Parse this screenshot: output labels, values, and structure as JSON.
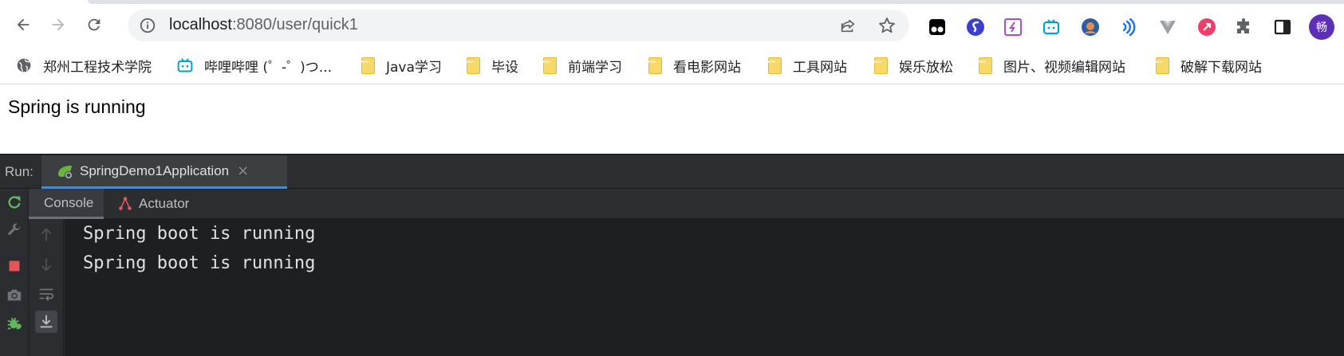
{
  "browser": {
    "url_host": "localhost",
    "url_rest": ":8080/user/quick1",
    "avatar_letter": "畅",
    "extensions": [
      "tampermonkey-icon",
      "s-icon",
      "feather-icon",
      "bilibili-ext-icon",
      "avatar-ext-icon",
      "wifi-ext-icon",
      "vue-icon",
      "ping-icon",
      "puzzle-icon",
      "sidepanel-icon"
    ]
  },
  "bookmarks": [
    {
      "label": "郑州工程技术学院",
      "icon": "globe-icon"
    },
    {
      "label": "哔哩哔哩 (゜-゜)つ...",
      "icon": "bilibili-icon"
    },
    {
      "label": "Java学习",
      "icon": "folder-icon"
    },
    {
      "label": "毕设",
      "icon": "folder-icon"
    },
    {
      "label": "前端学习",
      "icon": "folder-icon"
    },
    {
      "label": "看电影网站",
      "icon": "folder-icon"
    },
    {
      "label": "工具网站",
      "icon": "folder-icon"
    },
    {
      "label": "娱乐放松",
      "icon": "folder-icon"
    },
    {
      "label": "图片、视频编辑网站",
      "icon": "folder-icon"
    },
    {
      "label": "破解下载网站",
      "icon": "folder-icon"
    }
  ],
  "page": {
    "text": "Spring is running"
  },
  "ide": {
    "run_label": "Run:",
    "run_tab_title": "SpringDemo1Application",
    "close_glyph": "×",
    "subtabs": [
      "Console",
      "Actuator"
    ],
    "console_lines": [
      "Spring boot is running",
      "Spring boot is running"
    ],
    "accent": "#4a88c7"
  }
}
